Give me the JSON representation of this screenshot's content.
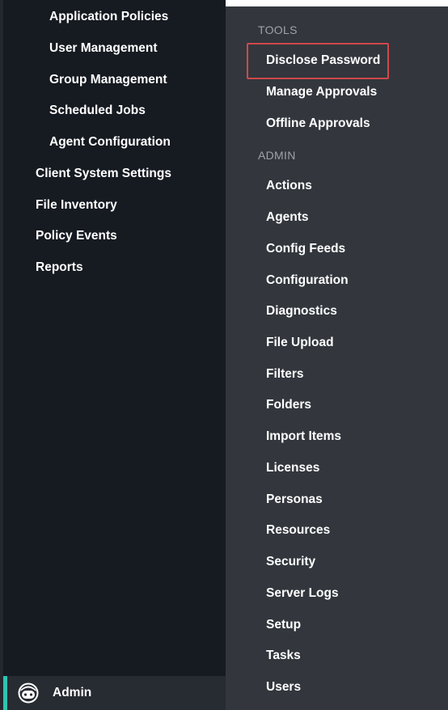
{
  "sidebar": {
    "items": [
      {
        "label": "Application Policies",
        "level": "sub"
      },
      {
        "label": "User Management",
        "level": "sub"
      },
      {
        "label": "Group Management",
        "level": "sub"
      },
      {
        "label": "Scheduled Jobs",
        "level": "sub"
      },
      {
        "label": "Agent Configuration",
        "level": "sub"
      },
      {
        "label": "Client System Settings",
        "level": "top"
      },
      {
        "label": "File Inventory",
        "level": "top"
      },
      {
        "label": "Policy Events",
        "level": "top"
      },
      {
        "label": "Reports",
        "level": "top"
      }
    ]
  },
  "flyout": {
    "tools_heading": "TOOLS",
    "tools": [
      {
        "label": "Disclose Password",
        "highlighted": true
      },
      {
        "label": "Manage Approvals"
      },
      {
        "label": "Offline Approvals"
      }
    ],
    "admin_heading": "ADMIN",
    "admin": [
      {
        "label": "Actions"
      },
      {
        "label": "Agents"
      },
      {
        "label": "Config Feeds"
      },
      {
        "label": "Configuration"
      },
      {
        "label": "Diagnostics"
      },
      {
        "label": "File Upload"
      },
      {
        "label": "Filters"
      },
      {
        "label": "Folders"
      },
      {
        "label": "Import Items"
      },
      {
        "label": "Licenses"
      },
      {
        "label": "Personas"
      },
      {
        "label": "Resources"
      },
      {
        "label": "Security"
      },
      {
        "label": "Server Logs"
      },
      {
        "label": "Setup"
      },
      {
        "label": "Tasks"
      },
      {
        "label": "Users"
      }
    ]
  },
  "user": {
    "name": "Admin",
    "avatar_icon": "robot-face-icon"
  },
  "colors": {
    "sidebar_bg": "#161a21",
    "flyout_bg": "#33373d",
    "highlight_border": "#d0484b",
    "accent": "#30c4b1",
    "heading_text": "#9fa2a7"
  }
}
